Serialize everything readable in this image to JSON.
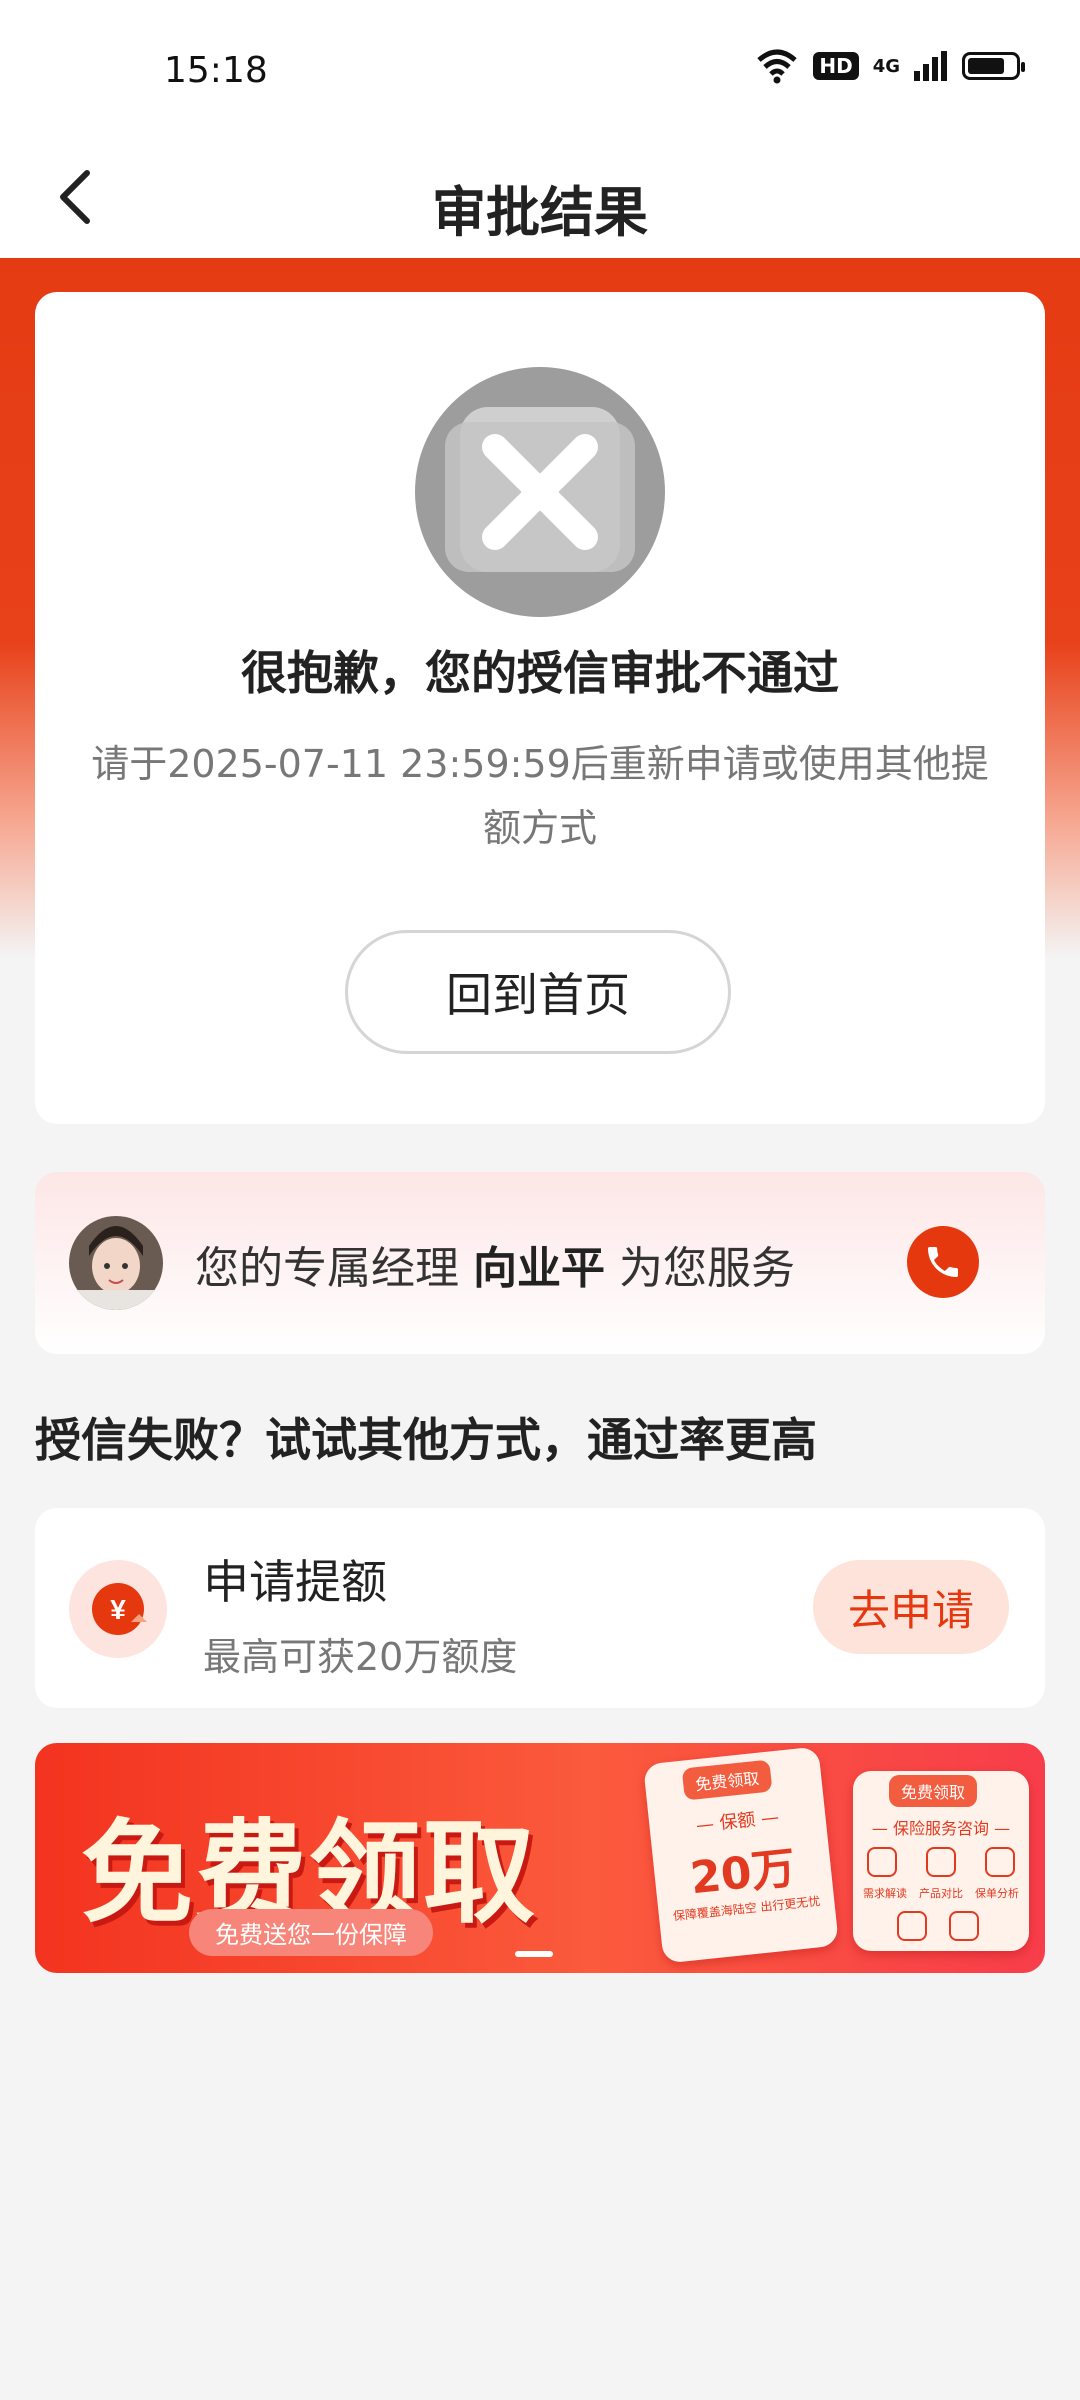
{
  "status_bar": {
    "time": "15:18",
    "hd": "HD",
    "network": "4G"
  },
  "nav": {
    "title": "审批结果"
  },
  "result": {
    "title": "很抱歉，您的授信审批不通过",
    "description": "请于2025-07-11 23:59:59后重新申请或使用其他提额方式",
    "home_button": "回到首页"
  },
  "manager": {
    "prefix": "您的专属经理",
    "name": "向业平",
    "suffix": "为您服务"
  },
  "section": {
    "title": "授信失败？试试其他方式，通过率更高"
  },
  "apply": {
    "title": "申请提额",
    "subtitle": "最高可获20万额度",
    "button": "去申请"
  },
  "banner": {
    "headline": "免费领取",
    "pill": "免费送您一份保障",
    "card1_tag": "免费领取",
    "card1_sub": "— 保额 —",
    "card1_amount": "20万",
    "card1_note": "保障覆盖海陆空 出行更无忧",
    "card2_tag": "免费领取",
    "card2_sub": "— 保险服务咨询 —",
    "card2_labels": [
      "需求解读",
      "产品对比",
      "保单分析"
    ]
  },
  "colors": {
    "accent": "#e5380f",
    "banner_red": "#f3331f"
  }
}
